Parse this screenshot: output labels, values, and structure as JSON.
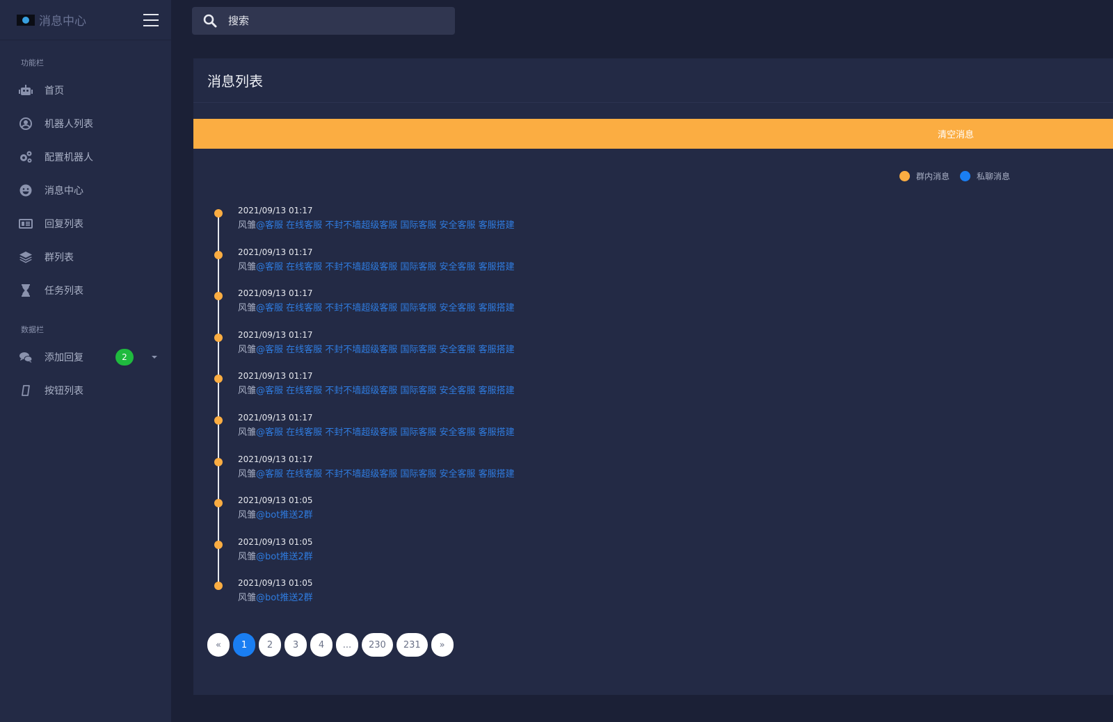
{
  "app": {
    "brand": "消息中心"
  },
  "search": {
    "placeholder": "搜索"
  },
  "sidebar": {
    "section1": "功能栏",
    "items": [
      {
        "label": "首页",
        "icon": "robot-icon"
      },
      {
        "label": "机器人列表",
        "icon": "user-circle-icon"
      },
      {
        "label": "配置机器人",
        "icon": "gears-icon"
      },
      {
        "label": "消息中心",
        "icon": "smile-icon"
      },
      {
        "label": "回复列表",
        "icon": "list-card-icon"
      },
      {
        "label": "群列表",
        "icon": "layers-icon"
      },
      {
        "label": "任务列表",
        "icon": "hourglass-icon"
      }
    ],
    "section2": "数据栏",
    "items2": [
      {
        "label": "添加回复",
        "icon": "comments-icon",
        "badge": "2"
      },
      {
        "label": "按钮列表",
        "icon": "tablet-icon"
      }
    ]
  },
  "main": {
    "title": "消息列表",
    "clear_button": "清空消息",
    "legend": [
      {
        "label": "群内消息",
        "color": "#fbad42"
      },
      {
        "label": "私聊消息",
        "color": "#1a7ef2"
      }
    ],
    "messages": [
      {
        "time": "2021/09/13 01:17",
        "sender": "风雏",
        "text": "@客服 在线客服 不封不墙超级客服 国际客服 安全客服 客服搭建"
      },
      {
        "time": "2021/09/13 01:17",
        "sender": "风雏",
        "text": "@客服 在线客服 不封不墙超级客服 国际客服 安全客服 客服搭建"
      },
      {
        "time": "2021/09/13 01:17",
        "sender": "风雏",
        "text": "@客服 在线客服 不封不墙超级客服 国际客服 安全客服 客服搭建"
      },
      {
        "time": "2021/09/13 01:17",
        "sender": "风雏",
        "text": "@客服 在线客服 不封不墙超级客服 国际客服 安全客服 客服搭建"
      },
      {
        "time": "2021/09/13 01:17",
        "sender": "风雏",
        "text": "@客服 在线客服 不封不墙超级客服 国际客服 安全客服 客服搭建"
      },
      {
        "time": "2021/09/13 01:17",
        "sender": "风雏",
        "text": "@客服 在线客服 不封不墙超级客服 国际客服 安全客服 客服搭建"
      },
      {
        "time": "2021/09/13 01:17",
        "sender": "风雏",
        "text": "@客服 在线客服 不封不墙超级客服 国际客服 安全客服 客服搭建"
      },
      {
        "time": "2021/09/13 01:05",
        "sender": "风雏",
        "text": "@bot推送2群"
      },
      {
        "time": "2021/09/13 01:05",
        "sender": "风雏",
        "text": "@bot推送2群"
      },
      {
        "time": "2021/09/13 01:05",
        "sender": "风雏",
        "text": "@bot推送2群"
      }
    ],
    "pagination": {
      "prev": "«",
      "pages": [
        "1",
        "2",
        "3",
        "4",
        "...",
        "230",
        "231"
      ],
      "active": "1",
      "next": "»"
    }
  }
}
